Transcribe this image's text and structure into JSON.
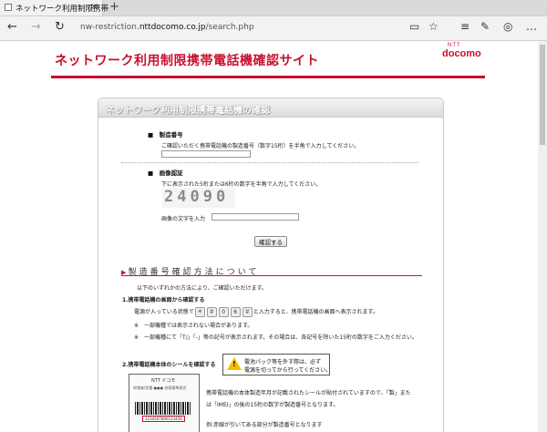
{
  "browser": {
    "tab_title": "ネットワーク利用制限携帯",
    "tab_close": "×",
    "new_tab": "+",
    "url_prefix": "nw-restriction.",
    "url_domain": "nttdocomo.co.jp",
    "url_path": "/search.php"
  },
  "header": {
    "logo_small": "NTT",
    "logo": "docomo",
    "site_title": "ネットワーク利用制限携帯電話機確認サイト"
  },
  "panel": {
    "title": "ネットワーク利用制限携帯電話機の確認",
    "serial_label": "■　製造番号",
    "serial_hint": "ご確認いただく携帯電話機の製造番号（数字15桁）を半角で入力してください。",
    "auth_label": "■　画像認証",
    "auth_hint": "下に表示された5桁または6桁の数字を半角で入力してください。",
    "captcha_text": "24090",
    "captcha_input_label": "画像の文字を入力",
    "submit": "確認する"
  },
  "howto": {
    "section_title": "製造番号確認方法について",
    "intro": "以下のいずれかの方法により、ご確認いただけます。",
    "m1_title": "1.携帯電話機の画面から確認する",
    "m1_text_a": "電源が入っている状態で",
    "m1_keys": [
      "＊",
      "＃",
      "0",
      "6",
      "＃"
    ],
    "m1_text_b": "と入力すると、携帯電話機の画面へ表示されます。",
    "note1": "※　一部機種では表示されない場合があります。",
    "note2": "※　一部機種にて「T/」「-」等の記号が表示されます。その場合は、各記号を除いた15桁の数字をご入力ください。",
    "m2_title": "2.携帯電話機本体のシールを確認する",
    "warn_line1": "電池パック等を外す際は、必ず",
    "warn_line2": "電源を切ってから行ってください。",
    "m2_text1": "携帯電話機の本体製造年月が記載されたシールが貼付されていますので、「製」また",
    "m2_text2": "は「IMEI」の後の15桁の数字が製造番号となります。",
    "m2_text3": "例:赤線が引いてある部分が製造番号となります",
    "label_brand": "NTT ドコモ",
    "label_lines": "申請者/型番 ●●● 技術基準適合",
    "label_imei": "1234567890123456"
  }
}
